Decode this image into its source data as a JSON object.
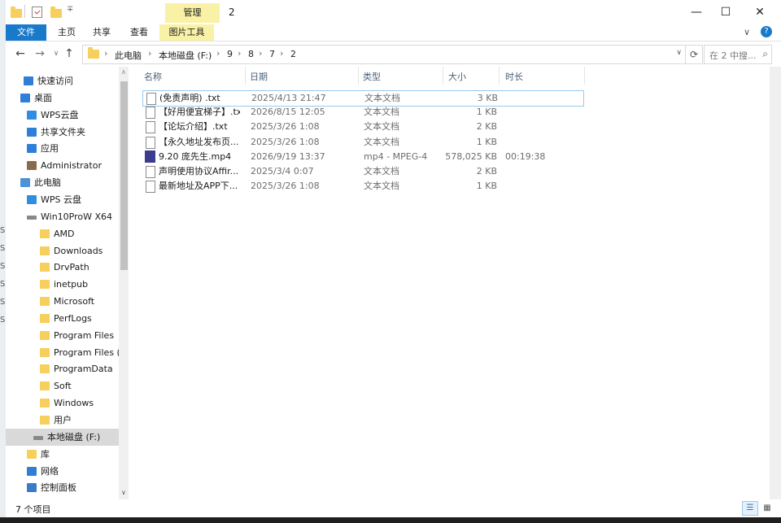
{
  "window": {
    "title": "2",
    "manage_label": "管理",
    "minimize": "—",
    "maximize": "☐",
    "close": "✕"
  },
  "ribbon": {
    "tabs": [
      "文件",
      "主页",
      "共享",
      "查看",
      "图片工具"
    ],
    "collapse": "∨",
    "help": "?"
  },
  "address": {
    "back": "←",
    "forward": "→",
    "recent": "∨",
    "up": "↑",
    "crumbs": [
      "此电脑",
      "本地磁盘 (F:)",
      "9",
      "8",
      "7",
      "2"
    ],
    "dropdown": "∨",
    "refresh": "⟳",
    "search_placeholder": "在 2 中搜..."
  },
  "navpane": {
    "items": [
      {
        "label": "快速访问",
        "icon": "star-icon"
      },
      {
        "label": "桌面",
        "icon": "desktop-icon"
      },
      {
        "label": "WPS云盘",
        "icon": "cloud-icon"
      },
      {
        "label": "共享文件夹",
        "icon": "share-icon"
      },
      {
        "label": "应用",
        "icon": "apps-icon"
      },
      {
        "label": "Administrator",
        "icon": "user-icon"
      },
      {
        "label": "此电脑",
        "icon": "pc-icon"
      },
      {
        "label": "WPS 云盘",
        "icon": "cloud-icon"
      },
      {
        "label": "Win10ProW X64",
        "icon": "drive-icon"
      },
      {
        "label": "AMD",
        "icon": "folder-icon"
      },
      {
        "label": "Downloads",
        "icon": "folder-icon"
      },
      {
        "label": "DrvPath",
        "icon": "folder-icon"
      },
      {
        "label": "inetpub",
        "icon": "folder-icon"
      },
      {
        "label": "Microsoft",
        "icon": "folder-icon"
      },
      {
        "label": "PerfLogs",
        "icon": "folder-icon"
      },
      {
        "label": "Program Files",
        "icon": "folder-icon"
      },
      {
        "label": "Program Files (",
        "icon": "folder-icon"
      },
      {
        "label": "ProgramData",
        "icon": "folder-icon"
      },
      {
        "label": "Soft",
        "icon": "folder-icon"
      },
      {
        "label": "Windows",
        "icon": "folder-icon"
      },
      {
        "label": "用户",
        "icon": "folder-icon"
      },
      {
        "label": "本地磁盘 (F:)",
        "icon": "drive-icon"
      },
      {
        "label": "库",
        "icon": "library-icon"
      },
      {
        "label": "网络",
        "icon": "network-icon"
      },
      {
        "label": "控制面板",
        "icon": "control-panel-icon"
      }
    ]
  },
  "filelist": {
    "columns": [
      "名称",
      "日期",
      "类型",
      "大小",
      "时长"
    ],
    "rows": [
      {
        "name": "(免责声明) .txt",
        "date": "2025/4/13 21:47",
        "type": "文本文档",
        "size": "3 KB",
        "duration": ""
      },
      {
        "name": "【好用便宜梯子】.txt",
        "date": "2026/8/15 12:05",
        "type": "文本文档",
        "size": "1 KB",
        "duration": ""
      },
      {
        "name": "【论坛介绍】.txt",
        "date": "2025/3/26 1:08",
        "type": "文本文档",
        "size": "2 KB",
        "duration": ""
      },
      {
        "name": "【永久地址发布页...",
        "date": "2025/3/26 1:08",
        "type": "文本文档",
        "size": "1 KB",
        "duration": ""
      },
      {
        "name": "9.20 庞先生.mp4",
        "date": "2026/9/19 13:37",
        "type": "mp4 - MPEG-4 ...",
        "size": "578,025 KB",
        "duration": "00:19:38"
      },
      {
        "name": "声明使用协议Affir...",
        "date": "2025/3/4 0:07",
        "type": "文本文档",
        "size": "2 KB",
        "duration": ""
      },
      {
        "name": "最新地址及APP下...",
        "date": "2025/3/26 1:08",
        "type": "文本文档",
        "size": "1 KB",
        "duration": ""
      }
    ]
  },
  "statusbar": {
    "count": "7 个项目"
  },
  "edge_chars": [
    "S",
    "S",
    "S",
    "S",
    "S",
    "S"
  ]
}
